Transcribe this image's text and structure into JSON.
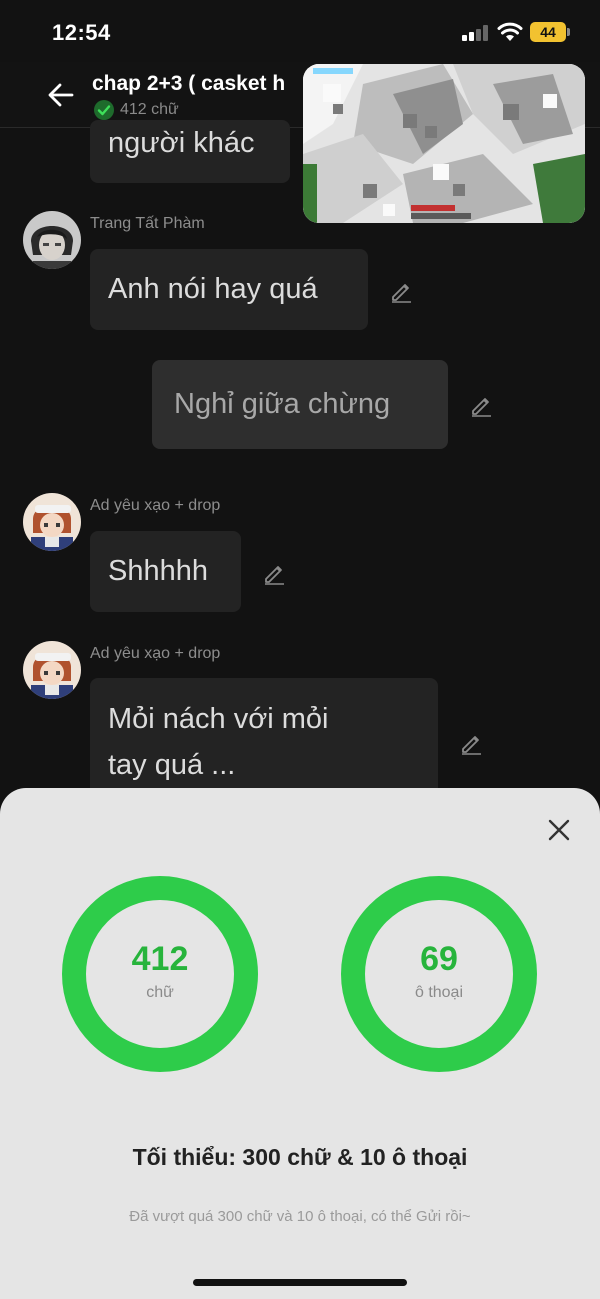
{
  "status_bar": {
    "time": "12:54",
    "battery": "44"
  },
  "header": {
    "title": "chap 2+3 (  casket h",
    "word_count": "412 chữ"
  },
  "messages": [
    {
      "sender": "",
      "text": "người khác",
      "side": "left"
    },
    {
      "sender": "Trang Tất Phàm",
      "text": "Anh nói hay quá",
      "side": "left"
    },
    {
      "sender": "",
      "text": "Nghỉ giữa chừng",
      "side": "right"
    },
    {
      "sender": "Ad yêu xạo + drop",
      "text": "Shhhhh",
      "side": "left"
    },
    {
      "sender": "Ad yêu xạo + drop",
      "text_line1": "Mỏi nách với mỏi",
      "text_line2": "tay quá ...",
      "side": "left"
    }
  ],
  "stats_sheet": {
    "words": {
      "value": "412",
      "label": "chữ",
      "progress": 1.0
    },
    "dialogs": {
      "value": "69",
      "label": "ô thoại",
      "progress": 1.0
    },
    "minimum": "Tối thiểu: 300 chữ & 10 ô thoại",
    "hint": "Đã vượt quá 300 chữ và 10 ô thoại, có thể Gửi rồi~"
  },
  "colors": {
    "accent": "#2ecc4a",
    "sheet_bg": "#e5e5e5",
    "chat_bg": "#121212"
  }
}
